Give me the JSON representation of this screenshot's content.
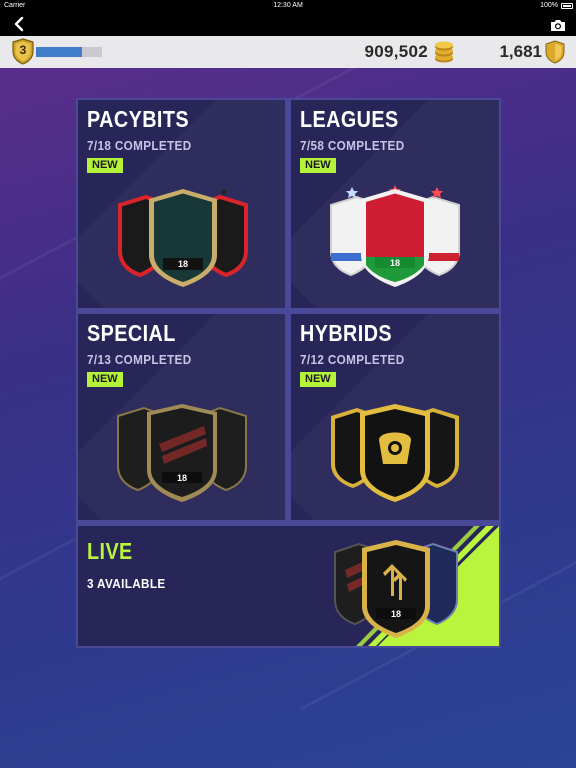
{
  "status_bar": {
    "carrier": "Carrier",
    "time": "12:30 AM",
    "battery": "100%"
  },
  "nav": {
    "back_icon": "chevron-left-icon",
    "camera_icon": "camera-icon"
  },
  "currency_bar": {
    "level": "3",
    "xp_progress": 0.7,
    "coins": "909,502",
    "points": "1,681"
  },
  "cards": [
    {
      "title": "PACYBITS",
      "subtitle": "7/18 COMPLETED",
      "badge": "NEW",
      "shield_label": "18"
    },
    {
      "title": "LEAGUES",
      "subtitle": "7/58 COMPLETED",
      "badge": "NEW",
      "shield_label": "18"
    },
    {
      "title": "SPECIAL",
      "subtitle": "7/13 COMPLETED",
      "badge": "NEW",
      "shield_label": "18"
    },
    {
      "title": "HYBRIDS",
      "subtitle": "7/12 COMPLETED",
      "badge": "NEW",
      "shield_label": ""
    }
  ],
  "live": {
    "title": "LIVE",
    "subtitle": "3 AVAILABLE",
    "shield_label": "18"
  },
  "colors": {
    "accent_green": "#b8f53c",
    "card_bg": "#282659",
    "xp_blue": "#3f7dc9"
  }
}
